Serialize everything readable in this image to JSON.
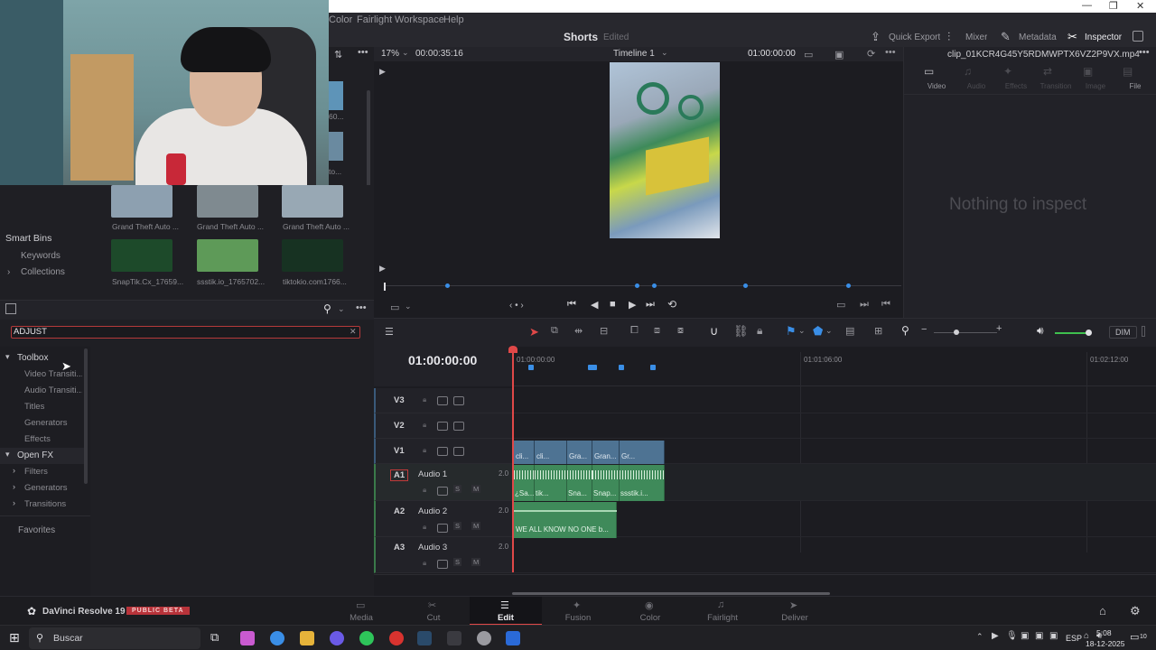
{
  "menu": {
    "items": [
      "Color",
      "Fairlight",
      "Workspace",
      "Help"
    ]
  },
  "window": {
    "minimize": "—",
    "maximize": "❐",
    "close": "✕"
  },
  "titlebar": {
    "project": "Shorts",
    "status": "Edited",
    "quick_export": "Quick Export",
    "mixer": "Mixer",
    "metadata": "Metadata",
    "inspector": "Inspector"
  },
  "viewer": {
    "zoom": "17%",
    "duration": "00:00:35:16",
    "timeline_name": "Timeline 1",
    "timecode": "01:00:00:00"
  },
  "inspector": {
    "clip_name": "clip_01KCR4G45Y5RDMWPTX6VZ2P9VX.mp4",
    "tabs": [
      "Video",
      "Audio",
      "Effects",
      "Transition",
      "Image",
      "File"
    ],
    "empty_text": "Nothing to inspect"
  },
  "media_pool": {
    "thumbs": [
      {
        "label": "Grand Theft Auto ...",
        "color": "#8da0b0"
      },
      {
        "label": "Grand Theft Auto ...",
        "color": "#7f8a90"
      },
      {
        "label": "Grand Theft Auto ...",
        "color": "#98a8b4"
      },
      {
        "label": "SnapTik.Cx_17659...",
        "color": "#1d4a2a"
      },
      {
        "label": "ssstik.io_1765702...",
        "color": "#5e9a58"
      },
      {
        "label": "tiktokio.com1766...",
        "color": "#173222"
      }
    ],
    "side_cut_labels": [
      "60...",
      "to..."
    ]
  },
  "bins": {
    "smart_bins": "Smart Bins",
    "keywords": "Keywords",
    "collections": "Collections"
  },
  "effects": {
    "search_value": "ADJUST",
    "clear": "✕",
    "tree": [
      {
        "label": "Toolbox",
        "level": 0,
        "arrow": "▾"
      },
      {
        "label": "Video Transiti...",
        "level": 1,
        "arrow": ""
      },
      {
        "label": "Audio Transiti...",
        "level": 1,
        "arrow": ""
      },
      {
        "label": "Titles",
        "level": 1,
        "arrow": ""
      },
      {
        "label": "Generators",
        "level": 1,
        "arrow": ""
      },
      {
        "label": "Effects",
        "level": 1,
        "arrow": ""
      },
      {
        "label": "Open FX",
        "level": 0,
        "arrow": "▾"
      },
      {
        "label": "Filters",
        "level": 1,
        "arrow": "›"
      },
      {
        "label": "Generators",
        "level": 1,
        "arrow": "›"
      },
      {
        "label": "Transitions",
        "level": 1,
        "arrow": "›"
      }
    ],
    "favorites": "Favorites"
  },
  "timeline": {
    "timecode": "01:00:00:00",
    "ruler": [
      "01:00:00:00",
      "01:01:06:00",
      "01:02:12:00"
    ],
    "dim": "DIM",
    "tracks": [
      {
        "id": "V3",
        "name": ""
      },
      {
        "id": "V2",
        "name": ""
      },
      {
        "id": "V1",
        "name": ""
      },
      {
        "id": "A1",
        "name": "Audio 1",
        "ch": "2.0",
        "s": "S",
        "m": "M"
      },
      {
        "id": "A2",
        "name": "Audio 2",
        "ch": "2.0",
        "s": "S",
        "m": "M"
      },
      {
        "id": "A3",
        "name": "Audio 3",
        "ch": "2.0",
        "s": "S",
        "m": "M"
      }
    ],
    "v1_clips": [
      "cli...",
      "cli...",
      "Gra...",
      "Gran...",
      "Gr..."
    ],
    "a1_clips": [
      "¿Sa...",
      "tik...",
      "Sna...",
      "Snap...",
      "ssstik.i..."
    ],
    "a2_clip": "WE ALL KNOW NO ONE b..."
  },
  "pages": {
    "brand": "DaVinci Resolve 19",
    "beta": "PUBLIC BETA",
    "tabs": [
      "Media",
      "Cut",
      "Edit",
      "Fusion",
      "Color",
      "Fairlight",
      "Deliver"
    ],
    "active": "Edit"
  },
  "taskbar": {
    "search": "Buscar",
    "lang": "ESP",
    "time": "5:08",
    "date": "18-12-2025",
    "notif": "10"
  },
  "colors": {
    "accent_red": "#e04848",
    "clip_video": "#4e7393",
    "clip_audio": "#3f8a5a",
    "marker": "#3a8ee6"
  }
}
